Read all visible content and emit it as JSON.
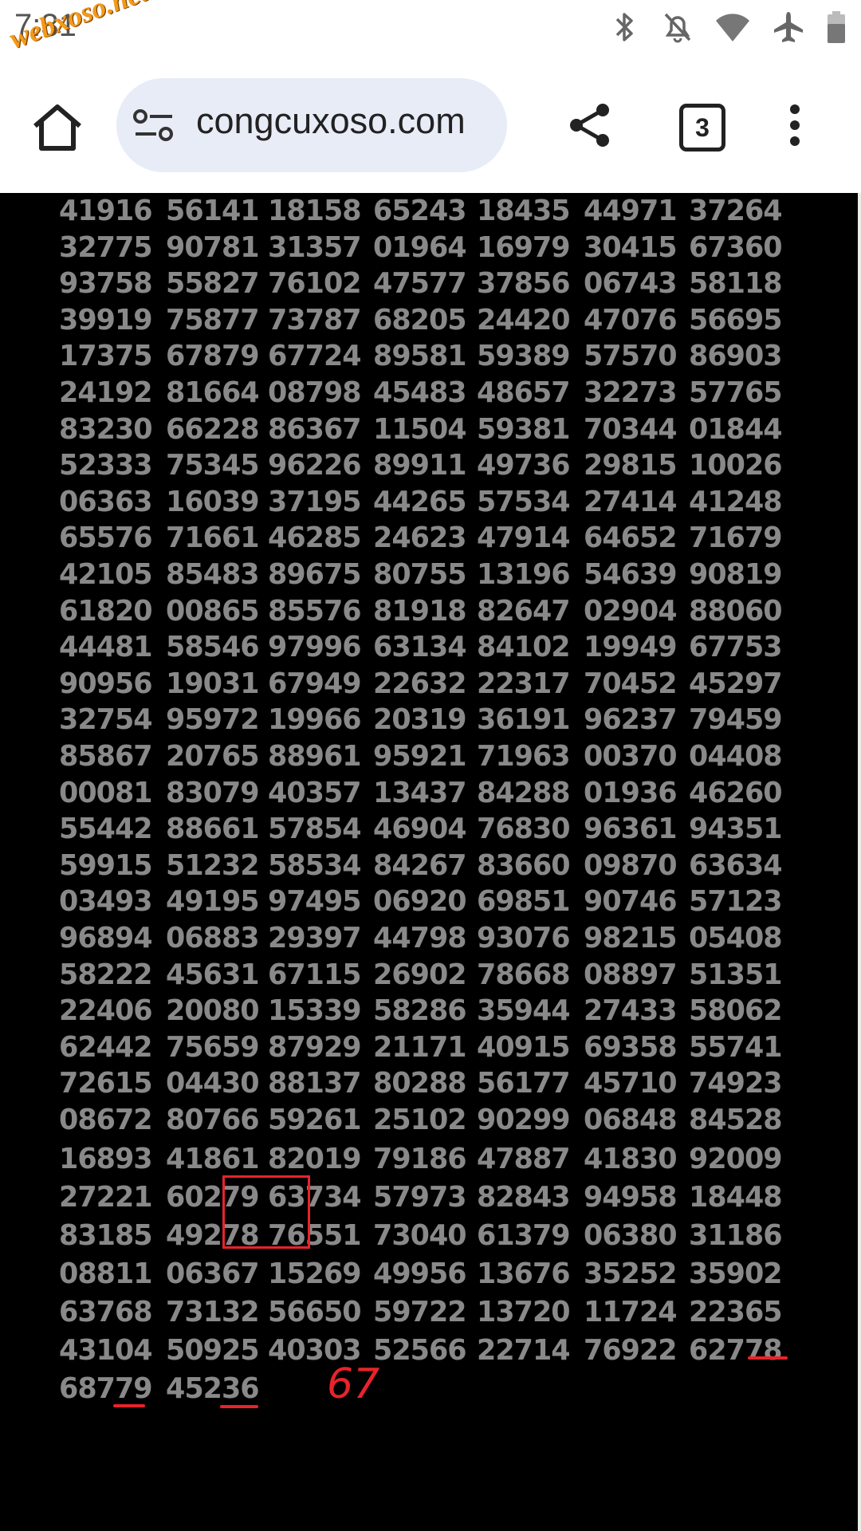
{
  "status_bar": {
    "time": "7:31",
    "watermark": "webxoso.net",
    "icons": [
      "bluetooth-icon",
      "notifications-off-icon",
      "wifi-icon",
      "airplane-mode-icon",
      "battery-icon"
    ]
  },
  "browser": {
    "url": "congcuxoso.com",
    "tab_count": "3",
    "icons": [
      "home-icon",
      "site-info-icon",
      "share-icon",
      "tabs-icon",
      "more-vert-icon"
    ]
  },
  "grid": {
    "rows": [
      [
        "41916",
        "56141",
        "18158",
        "65243",
        "18435",
        "44971",
        "37264"
      ],
      [
        "32775",
        "90781",
        "31357",
        "01964",
        "16979",
        "30415",
        "67360"
      ],
      [
        "93758",
        "55827",
        "76102",
        "47577",
        "37856",
        "06743",
        "58118"
      ],
      [
        "39919",
        "75877",
        "73787",
        "68205",
        "24420",
        "47076",
        "56695"
      ],
      [
        "17375",
        "67879",
        "67724",
        "89581",
        "59389",
        "57570",
        "86903"
      ],
      [
        "24192",
        "81664",
        "08798",
        "45483",
        "48657",
        "32273",
        "57765"
      ],
      [
        "83230",
        "66228",
        "86367",
        "11504",
        "59381",
        "70344",
        "01844"
      ],
      [
        "52333",
        "75345",
        "96226",
        "89911",
        "49736",
        "29815",
        "10026"
      ],
      [
        "06363",
        "16039",
        "37195",
        "44265",
        "57534",
        "27414",
        "41248"
      ],
      [
        "65576",
        "71661",
        "46285",
        "24623",
        "47914",
        "64652",
        "71679"
      ],
      [
        "42105",
        "85483",
        "89675",
        "80755",
        "13196",
        "54639",
        "90819"
      ],
      [
        "61820",
        "00865",
        "85576",
        "81918",
        "82647",
        "02904",
        "88060"
      ],
      [
        "44481",
        "58546",
        "97996",
        "63134",
        "84102",
        "19949",
        "67753"
      ],
      [
        "90956",
        "19031",
        "67949",
        "22632",
        "22317",
        "70452",
        "45297"
      ],
      [
        "32754",
        "95972",
        "19966",
        "20319",
        "36191",
        "96237",
        "79459"
      ],
      [
        "85867",
        "20765",
        "88961",
        "95921",
        "71963",
        "00370",
        "04408"
      ],
      [
        "00081",
        "83079",
        "40357",
        "13437",
        "84288",
        "01936",
        "46260"
      ],
      [
        "55442",
        "88661",
        "57854",
        "46904",
        "76830",
        "96361",
        "94351"
      ],
      [
        "59915",
        "51232",
        "58534",
        "84267",
        "83660",
        "09870",
        "63634"
      ],
      [
        "03493",
        "49195",
        "97495",
        "06920",
        "69851",
        "90746",
        "57123"
      ],
      [
        "96894",
        "06883",
        "29397",
        "44798",
        "93076",
        "98215",
        "05408"
      ],
      [
        "58222",
        "45631",
        "67115",
        "26902",
        "78668",
        "08897",
        "51351"
      ],
      [
        "22406",
        "20080",
        "15339",
        "58286",
        "35944",
        "27433",
        "58062"
      ],
      [
        "62442",
        "75659",
        "87929",
        "21171",
        "40915",
        "69358",
        "55741"
      ],
      [
        "72615",
        "04430",
        "88137",
        "80288",
        "56177",
        "45710",
        "74923"
      ],
      [
        "08672",
        "80766",
        "59261",
        "25102",
        "90299",
        "06848",
        "84528"
      ],
      [
        "16893",
        "41861",
        "82019",
        "79186",
        "47887",
        "41830",
        "92009"
      ],
      [
        "27221",
        "60279",
        "63734",
        "57973",
        "82843",
        "94958",
        "18448"
      ],
      [
        "83185",
        "49278",
        "76551",
        "73040",
        "61379",
        "06380",
        "31186"
      ],
      [
        "08811",
        "06367",
        "15269",
        "49956",
        "13676",
        "35252",
        "35902"
      ],
      [
        "63768",
        "73132",
        "56650",
        "59722",
        "13720",
        "11724",
        "22365"
      ],
      [
        "43104",
        "50925",
        "40303",
        "52566",
        "22714",
        "76922",
        "62778"
      ],
      [
        "68779",
        "45236"
      ]
    ]
  },
  "annotation": {
    "handwritten_number": "67",
    "color": "#e8232a"
  },
  "colors": {
    "number_text": "#898989",
    "content_background": "#000000",
    "url_box": "#e8ecf7"
  }
}
